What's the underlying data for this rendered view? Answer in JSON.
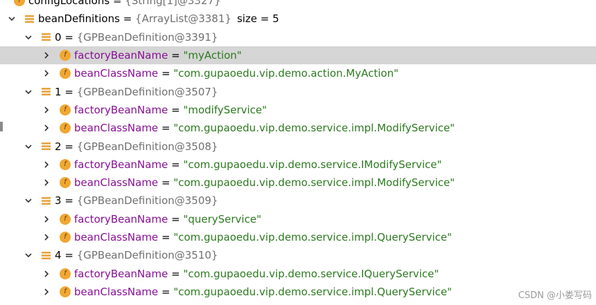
{
  "tree": {
    "top_partial": {
      "name": "configLocations",
      "value": "{String[1]@3327}"
    },
    "bean_definitions": {
      "name": "beanDefinitions",
      "value": "{ArrayList@3381}",
      "size_text": "size = 5"
    },
    "items": [
      {
        "index": "0",
        "value": "{GPBeanDefinition@3391}",
        "factory_name": "factoryBeanName",
        "factory_value": "\"myAction\"",
        "class_name": "beanClassName",
        "class_value": "\"com.gupaoedu.vip.demo.action.MyAction\""
      },
      {
        "index": "1",
        "value": "{GPBeanDefinition@3507}",
        "factory_name": "factoryBeanName",
        "factory_value": "\"modifyService\"",
        "class_name": "beanClassName",
        "class_value": "\"com.gupaoedu.vip.demo.service.impl.ModifyService\""
      },
      {
        "index": "2",
        "value": "{GPBeanDefinition@3508}",
        "factory_name": "factoryBeanName",
        "factory_value": "\"com.gupaoedu.vip.demo.service.IModifyService\"",
        "class_name": "beanClassName",
        "class_value": "\"com.gupaoedu.vip.demo.service.impl.ModifyService\""
      },
      {
        "index": "3",
        "value": "{GPBeanDefinition@3509}",
        "factory_name": "factoryBeanName",
        "factory_value": "\"queryService\"",
        "class_name": "beanClassName",
        "class_value": "\"com.gupaoedu.vip.demo.service.impl.QueryService\""
      },
      {
        "index": "4",
        "value": "{GPBeanDefinition@3510}",
        "factory_name": "factoryBeanName",
        "factory_value": "\"com.gupaoedu.vip.demo.service.IQueryService\"",
        "class_name": "beanClassName",
        "class_value": "\"com.gupaoedu.vip.demo.service.impl.QueryService\""
      }
    ],
    "field_icon_letter": "f",
    "equals": "="
  },
  "watermark": "CSDN @小娄写码",
  "colors": {
    "field_name": "#871094",
    "string_value": "#2c7a1f",
    "object_ref": "#707070",
    "field_icon": "#f0a732",
    "list_icon": "#e8a33c",
    "selection": "#d5d5d5"
  },
  "icons": {
    "collapsed": "chevron-right-icon",
    "expanded": "chevron-down-icon",
    "list": "list-icon",
    "field": "field-icon"
  }
}
